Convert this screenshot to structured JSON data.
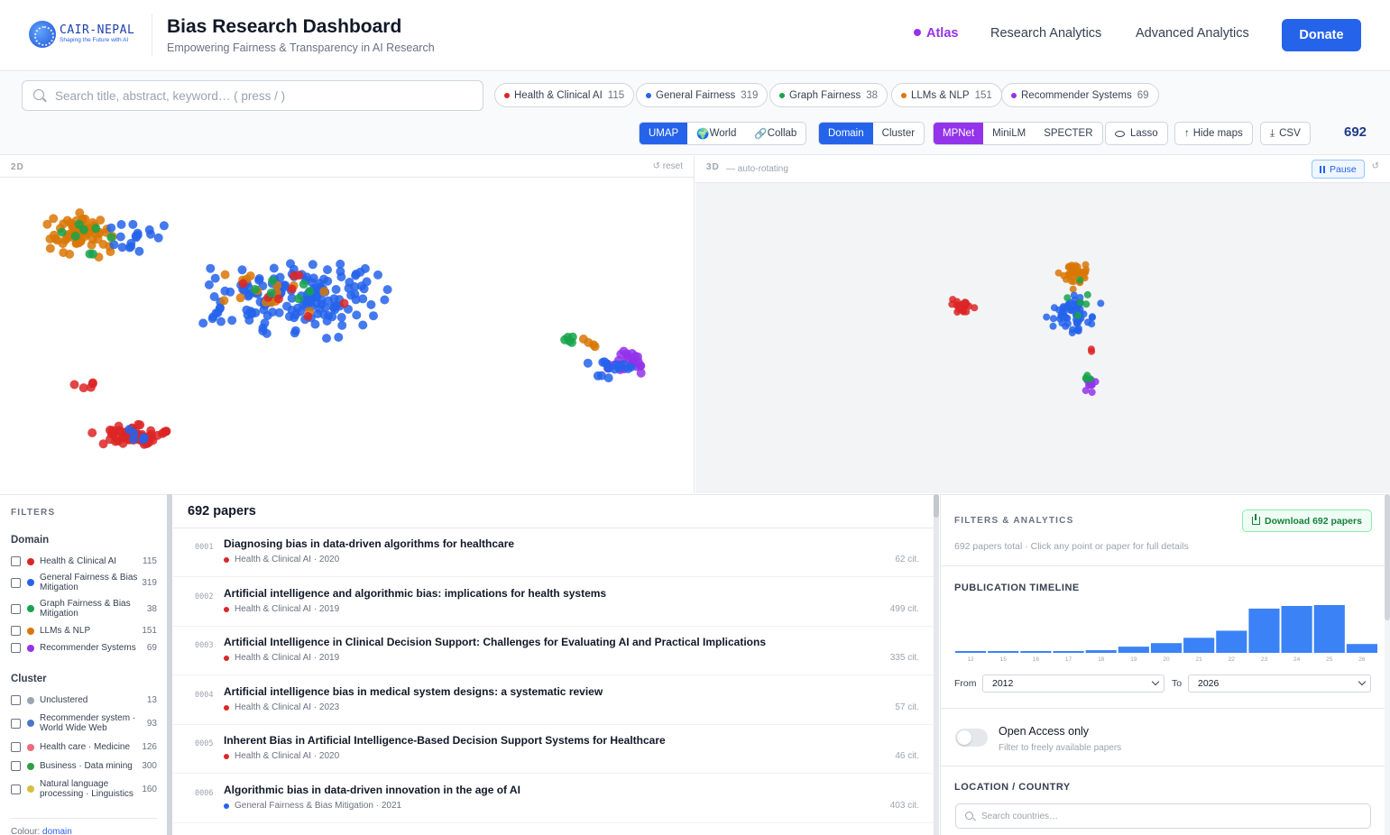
{
  "header": {
    "logo": {
      "name": "CAIR-NEPAL",
      "tagline": "Shaping the Future with AI"
    },
    "title": "Bias Research Dashboard",
    "subtitle": "Empowering Fairness & Transparency in AI Research",
    "nav": [
      {
        "label": "Atlas",
        "active": true
      },
      {
        "label": "Research Analytics",
        "active": false
      },
      {
        "label": "Advanced Analytics",
        "active": false
      }
    ],
    "donate_label": "Donate"
  },
  "toolbar": {
    "search_placeholder": "Search title, abstract, keyword… ( press / )",
    "domain_chips": [
      {
        "label": "Health & Clinical AI",
        "count": "115",
        "color": "#dc2626"
      },
      {
        "label": "General Fairness",
        "count": "319",
        "color": "#2563eb"
      },
      {
        "label": "Graph Fairness",
        "count": "38",
        "color": "#16a34a"
      },
      {
        "label": "LLMs & NLP",
        "count": "151",
        "color": "#d97706"
      },
      {
        "label": "Recommender Systems",
        "count": "69",
        "color": "#9333ea"
      }
    ],
    "view_options": [
      "UMAP",
      "World",
      "Collab"
    ],
    "view_icons": [
      "globe-icon",
      "link-icon"
    ],
    "color_options": [
      "Domain",
      "Cluster"
    ],
    "model_options": [
      "MPNet",
      "MiniLM",
      "SPECTER"
    ],
    "lasso_label": "Lasso",
    "hide_maps_label": "Hide maps",
    "csv_label": "CSV",
    "total_count": "692"
  },
  "maps": {
    "left": {
      "label": "2D",
      "reset": "↺ reset"
    },
    "right": {
      "label": "3D",
      "status": "— auto-rotating",
      "pause_label": "Pause",
      "reset": "↺"
    }
  },
  "filters": {
    "title": "FILTERS",
    "domain_title": "Domain",
    "domains": [
      {
        "label": "Health & Clinical AI",
        "count": "115",
        "color": "#dc2626"
      },
      {
        "label": "General Fairness & Bias Mitigation",
        "count": "319",
        "color": "#2563eb"
      },
      {
        "label": "Graph Fairness & Bias Mitigation",
        "count": "38",
        "color": "#16a34a"
      },
      {
        "label": "LLMs & NLP",
        "count": "151",
        "color": "#d97706"
      },
      {
        "label": "Recommender Systems",
        "count": "69",
        "color": "#9333ea"
      }
    ],
    "cluster_title": "Cluster",
    "clusters": [
      {
        "label": "Unclustered",
        "count": "13",
        "color": "#9ca3af"
      },
      {
        "label": "Recommender system · World Wide Web",
        "count": "93",
        "color": "#4b77c9"
      },
      {
        "label": "Health care · Medicine",
        "count": "126",
        "color": "#f06a79"
      },
      {
        "label": "Business · Data mining",
        "count": "300",
        "color": "#2f9e44"
      },
      {
        "label": "Natural language processing · Linguistics",
        "count": "160",
        "color": "#d4c040"
      }
    ],
    "colour_label": "Colour:",
    "colour_value": "domain"
  },
  "papers": {
    "heading": "692 papers",
    "items": [
      {
        "num": "0001",
        "title": "Diagnosing bias in data-driven algorithms for healthcare",
        "domain": "Health & Clinical AI",
        "year": "· 2020",
        "citations": "62 cit.",
        "color": "#dc2626"
      },
      {
        "num": "0002",
        "title": "Artificial intelligence and algorithmic bias: implications for health systems",
        "domain": "Health & Clinical AI",
        "year": "· 2019",
        "citations": "499 cit.",
        "color": "#dc2626"
      },
      {
        "num": "0003",
        "title": "Artificial Intelligence in Clinical Decision Support: Challenges for Evaluating AI and Practical Implications",
        "domain": "Health & Clinical AI",
        "year": "· 2019",
        "citations": "335 cit.",
        "color": "#dc2626"
      },
      {
        "num": "0004",
        "title": "Artificial intelligence bias in medical system designs: a systematic review",
        "domain": "Health & Clinical AI",
        "year": "· 2023",
        "citations": "57 cit.",
        "color": "#dc2626"
      },
      {
        "num": "0005",
        "title": "Inherent Bias in Artificial Intelligence-Based Decision Support Systems for Healthcare",
        "domain": "Health & Clinical AI",
        "year": "· 2020",
        "citations": "46 cit.",
        "color": "#dc2626"
      },
      {
        "num": "0006",
        "title": "Algorithmic bias in data-driven innovation in the age of AI",
        "domain": "General Fairness & Bias Mitigation",
        "year": "· 2021",
        "citations": "403 cit.",
        "color": "#2563eb"
      }
    ]
  },
  "analytics": {
    "title": "FILTERS & ANALYTICS",
    "download_label": "Download 692 papers",
    "summary": "692 papers total · Click any point or paper for full details",
    "timeline_title": "PUBLICATION TIMELINE",
    "timeline": {
      "labels": [
        "12",
        "15",
        "16",
        "17",
        "18",
        "19",
        "20",
        "21",
        "22",
        "23",
        "24",
        "25",
        "26"
      ],
      "values": [
        2,
        2,
        2,
        2,
        3,
        7,
        11,
        17,
        25,
        50,
        53,
        54,
        10
      ]
    },
    "from_label": "From",
    "from_value": "2012",
    "to_label": "To",
    "to_value": "2026",
    "open_access_title": "Open Access only",
    "open_access_sub": "Filter to freely available papers",
    "location_title": "LOCATION / COUNTRY",
    "country_placeholder": "Search countries…"
  },
  "colors": {
    "health": "#dc2626",
    "general": "#2563eb",
    "graph": "#16a34a",
    "llm": "#d97706",
    "recsys": "#9333ea",
    "accent": "#2563eb"
  }
}
